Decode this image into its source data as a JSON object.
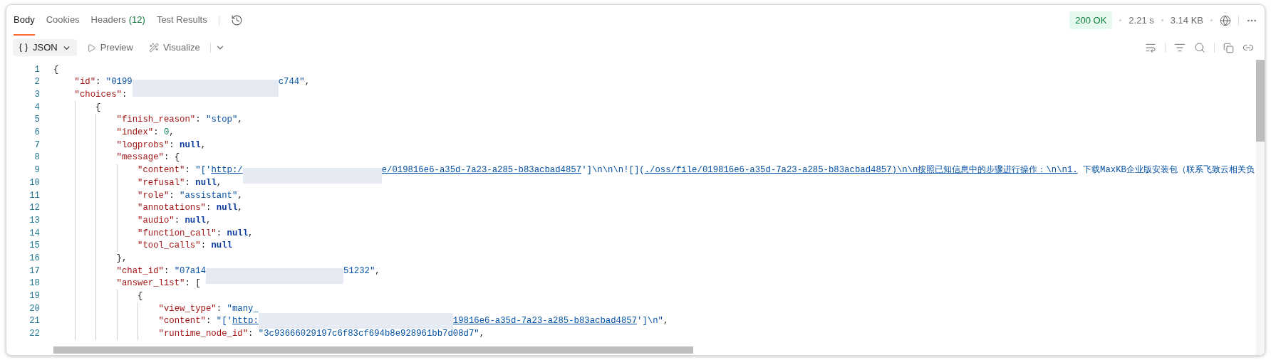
{
  "tabs": [
    {
      "label": "Body",
      "selected": true
    },
    {
      "label": "Cookies",
      "selected": false
    },
    {
      "label": "Headers",
      "count": "(12)",
      "selected": false
    },
    {
      "label": "Test Results",
      "selected": false
    }
  ],
  "status": {
    "code": "200 OK",
    "time": "2.21 s",
    "size": "3.14 KB"
  },
  "view_modes": [
    {
      "kind": "format",
      "label": "JSON",
      "selected": true
    },
    {
      "kind": "preview",
      "label": "Preview",
      "selected": false
    },
    {
      "kind": "visualize",
      "label": "Visualize",
      "selected": false
    }
  ],
  "code": [
    {
      "number": "1",
      "tokens": [
        {
          "kind": "punct",
          "text": "{"
        }
      ],
      "children": [
        {
          "number": "2",
          "tokens": [
            {
              "kind": "key",
              "text": "\"id\""
            },
            {
              "kind": "punct",
              "text": ": "
            },
            {
              "kind": "string",
              "text": "\"0199"
            },
            {
              "kind": "redacted"
            },
            {
              "kind": "string",
              "text": "c744\""
            },
            {
              "kind": "punct",
              "text": ","
            }
          ]
        },
        {
          "number": "3",
          "tokens": [
            {
              "kind": "key",
              "text": "\"choices\""
            },
            {
              "kind": "punct",
              "text": ":"
            }
          ],
          "children": [
            {
              "number": "4",
              "tokens": [
                {
                  "kind": "punct",
                  "text": "{"
                }
              ],
              "children": [
                {
                  "number": "5",
                  "tokens": [
                    {
                      "kind": "key",
                      "text": "\"finish_reason\""
                    },
                    {
                      "kind": "punct",
                      "text": ": "
                    },
                    {
                      "kind": "string",
                      "text": "\"stop\""
                    },
                    {
                      "kind": "punct",
                      "text": ","
                    }
                  ]
                },
                {
                  "number": "6",
                  "tokens": [
                    {
                      "kind": "key",
                      "text": "\"index\""
                    },
                    {
                      "kind": "punct",
                      "text": ": "
                    },
                    {
                      "kind": "number",
                      "text": "0"
                    },
                    {
                      "kind": "punct",
                      "text": ","
                    }
                  ]
                },
                {
                  "number": "7",
                  "tokens": [
                    {
                      "kind": "key",
                      "text": "\"logprobs\""
                    },
                    {
                      "kind": "punct",
                      "text": ": "
                    },
                    {
                      "kind": "null",
                      "text": "null"
                    },
                    {
                      "kind": "punct",
                      "text": ","
                    }
                  ]
                },
                {
                  "number": "8",
                  "tokens": [
                    {
                      "kind": "key",
                      "text": "\"message\""
                    },
                    {
                      "kind": "punct",
                      "text": ": {"
                    }
                  ],
                  "children": [
                    {
                      "number": "9",
                      "tokens": [
                        {
                          "kind": "key",
                          "text": "\"content\""
                        },
                        {
                          "kind": "punct",
                          "text": ": "
                        },
                        {
                          "kind": "string",
                          "text": "\"['"
                        },
                        {
                          "kind": "link",
                          "text": "http:/"
                        },
                        {
                          "kind": "redacted"
                        },
                        {
                          "kind": "link",
                          "text": "e/019816e6-a35d-7a23-a285-b83acbad4857"
                        },
                        {
                          "kind": "string",
                          "text": "']\\n\\n\\n![]("
                        },
                        {
                          "kind": "link",
                          "text": "./oss/file/019816e6-a35d-7a23-a285-b83acbad4857)\\n\\n按照已知信息中的步骤进行操作：\\n\\n1."
                        },
                        {
                          "kind": "string",
                          "text": " 下载MaxKB企业版安装包（联系飞致云相关负"
                        }
                      ]
                    },
                    {
                      "number": "10",
                      "tokens": [
                        {
                          "kind": "key",
                          "text": "\"refusal\""
                        },
                        {
                          "kind": "punct",
                          "text": ": "
                        },
                        {
                          "kind": "null",
                          "text": "null"
                        },
                        {
                          "kind": "punct",
                          "text": ","
                        }
                      ]
                    },
                    {
                      "number": "11",
                      "tokens": [
                        {
                          "kind": "key",
                          "text": "\"role\""
                        },
                        {
                          "kind": "punct",
                          "text": ": "
                        },
                        {
                          "kind": "string",
                          "text": "\"assistant\""
                        },
                        {
                          "kind": "punct",
                          "text": ","
                        }
                      ]
                    },
                    {
                      "number": "12",
                      "tokens": [
                        {
                          "kind": "key",
                          "text": "\"annotations\""
                        },
                        {
                          "kind": "punct",
                          "text": ": "
                        },
                        {
                          "kind": "null",
                          "text": "null"
                        },
                        {
                          "kind": "punct",
                          "text": ","
                        }
                      ]
                    },
                    {
                      "number": "13",
                      "tokens": [
                        {
                          "kind": "key",
                          "text": "\"audio\""
                        },
                        {
                          "kind": "punct",
                          "text": ": "
                        },
                        {
                          "kind": "null",
                          "text": "null"
                        },
                        {
                          "kind": "punct",
                          "text": ","
                        }
                      ]
                    },
                    {
                      "number": "14",
                      "tokens": [
                        {
                          "kind": "key",
                          "text": "\"function_call\""
                        },
                        {
                          "kind": "punct",
                          "text": ": "
                        },
                        {
                          "kind": "null",
                          "text": "null"
                        },
                        {
                          "kind": "punct",
                          "text": ","
                        }
                      ]
                    },
                    {
                      "number": "15",
                      "tokens": [
                        {
                          "kind": "key",
                          "text": "\"tool_calls\""
                        },
                        {
                          "kind": "punct",
                          "text": ": "
                        },
                        {
                          "kind": "null",
                          "text": "null"
                        }
                      ]
                    }
                  ]
                },
                {
                  "number": "16",
                  "tokens": [
                    {
                      "kind": "punct",
                      "text": "},"
                    }
                  ]
                },
                {
                  "number": "17",
                  "tokens": [
                    {
                      "kind": "key",
                      "text": "\"chat_id\""
                    },
                    {
                      "kind": "punct",
                      "text": ": "
                    },
                    {
                      "kind": "string",
                      "text": "\"07a14"
                    },
                    {
                      "kind": "redacted"
                    },
                    {
                      "kind": "string",
                      "text": "51232\""
                    },
                    {
                      "kind": "punct",
                      "text": ","
                    }
                  ]
                },
                {
                  "number": "18",
                  "tokens": [
                    {
                      "kind": "key",
                      "text": "\"answer_list\""
                    },
                    {
                      "kind": "punct",
                      "text": ": ["
                    }
                  ],
                  "children": [
                    {
                      "number": "19",
                      "tokens": [
                        {
                          "kind": "punct",
                          "text": "{"
                        }
                      ],
                      "children": [
                        {
                          "number": "20",
                          "tokens": [
                            {
                              "kind": "key",
                              "text": "\"view_type\""
                            },
                            {
                              "kind": "punct",
                              "text": ": "
                            },
                            {
                              "kind": "string",
                              "text": "\"many_"
                            }
                          ]
                        },
                        {
                          "number": "21",
                          "tokens": [
                            {
                              "kind": "key",
                              "text": "\"content\""
                            },
                            {
                              "kind": "punct",
                              "text": ": "
                            },
                            {
                              "kind": "string",
                              "text": "\"['"
                            },
                            {
                              "kind": "link",
                              "text": "http:"
                            },
                            {
                              "kind": "redacted"
                            },
                            {
                              "kind": "link",
                              "text": "19816e6-a35d-7a23-a285-b83acbad4857"
                            },
                            {
                              "kind": "string",
                              "text": "']\\n\""
                            },
                            {
                              "kind": "punct",
                              "text": ","
                            }
                          ]
                        },
                        {
                          "number": "22",
                          "tokens": [
                            {
                              "kind": "key",
                              "text": "\"runtime_node_id\""
                            },
                            {
                              "kind": "punct",
                              "text": ": "
                            },
                            {
                              "kind": "string",
                              "text": "\"3c93666029197c6f83cf694b8e928961bb7d08d7\""
                            },
                            {
                              "kind": "punct",
                              "text": ","
                            }
                          ]
                        }
                      ]
                    }
                  ]
                }
              ]
            }
          ]
        }
      ]
    }
  ]
}
